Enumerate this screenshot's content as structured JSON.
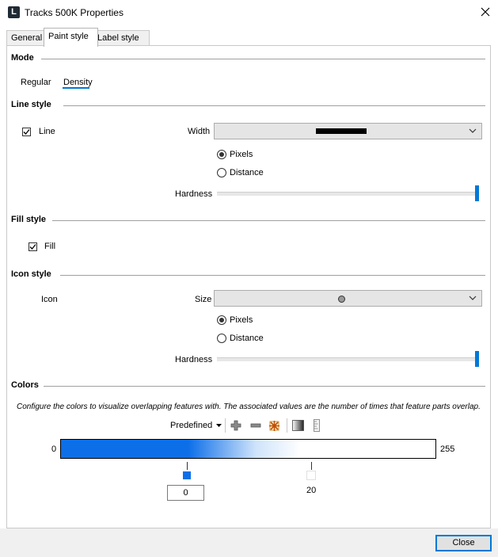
{
  "window": {
    "title": "Tracks 500K Properties",
    "app_icon_letter": "L"
  },
  "tabs": [
    {
      "label": "General",
      "active": false
    },
    {
      "label": "Paint style",
      "active": true
    },
    {
      "label": "Label style",
      "active": false
    }
  ],
  "mode": {
    "section_title": "Mode",
    "options": [
      "Regular",
      "Density"
    ],
    "selected": "Density"
  },
  "line_style": {
    "section_title": "Line style",
    "checkbox_label": "Line",
    "checked": true,
    "width_label": "Width",
    "unit_options": [
      "Pixels",
      "Distance"
    ],
    "unit_selected": "Pixels",
    "hardness_label": "Hardness",
    "hardness_value_pct": 100
  },
  "fill_style": {
    "section_title": "Fill style",
    "checkbox_label": "Fill",
    "checked": true
  },
  "icon_style": {
    "section_title": "Icon style",
    "icon_label": "Icon",
    "size_label": "Size",
    "unit_options": [
      "Pixels",
      "Distance"
    ],
    "unit_selected": "Pixels",
    "hardness_label": "Hardness",
    "hardness_value_pct": 100
  },
  "colors": {
    "section_title": "Colors",
    "description": "Configure the colors to visualize overlapping features with. The associated values are the number of times that feature parts overlap.",
    "predefined_label": "Predefined",
    "range_min": "0",
    "range_max": "255",
    "stops": [
      {
        "value": "0",
        "color": "#0d6fe8",
        "selected": true
      },
      {
        "value": "20",
        "color": "#ffffff",
        "selected": false
      }
    ],
    "selected_stop_value": "0",
    "stop2_label": "20"
  },
  "footer": {
    "close_label": "Close"
  },
  "accent_color": "#0078d7"
}
